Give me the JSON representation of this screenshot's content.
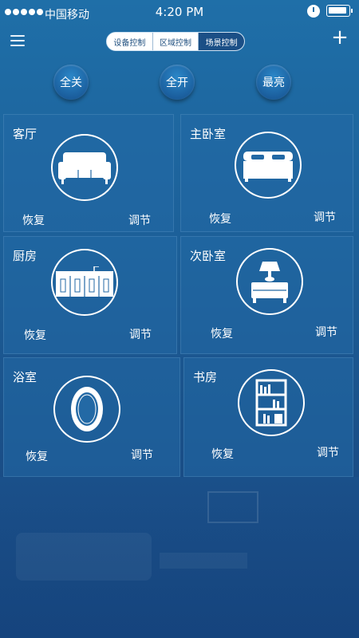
{
  "status_bar": {
    "carrier": "中国移动",
    "time": "4:20 PM"
  },
  "tabs": [
    {
      "label": "设备控制",
      "active": false
    },
    {
      "label": "区域控制",
      "active": false
    },
    {
      "label": "场景控制",
      "active": true
    }
  ],
  "controls": {
    "all_off": "全关",
    "all_on": "全开",
    "brightest": "最亮"
  },
  "rooms": [
    {
      "name": "客厅",
      "icon": "sofa-icon",
      "restore": "恢复",
      "adjust": "调节"
    },
    {
      "name": "主卧室",
      "icon": "bed-icon",
      "restore": "恢复",
      "adjust": "调节"
    },
    {
      "name": "厨房",
      "icon": "kitchen-icon",
      "restore": "恢复",
      "adjust": "调节"
    },
    {
      "name": "次卧室",
      "icon": "lamp-nightstand-icon",
      "restore": "恢复",
      "adjust": "调节"
    },
    {
      "name": "浴室",
      "icon": "mirror-icon",
      "restore": "恢复",
      "adjust": "调节"
    },
    {
      "name": "书房",
      "icon": "bookshelf-icon",
      "restore": "恢复",
      "adjust": "调节"
    }
  ],
  "colors": {
    "background": "#1c5f98",
    "active_tab": "#1b4f86",
    "card": "#2369a5"
  }
}
